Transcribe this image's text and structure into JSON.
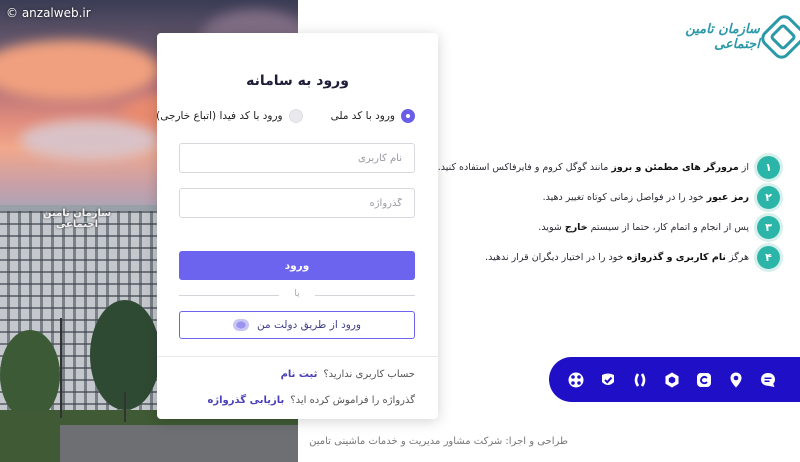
{
  "watermark": "© anzalweb.ir",
  "photo": {
    "building_sign": "سازمان تامین اجتماعی"
  },
  "brand": {
    "logo_text": "سازمان تامین اجتماعی",
    "primary_color": "#6c63ef",
    "accent_color": "#2bb5a8",
    "bar_color": "#1f10c8"
  },
  "login": {
    "title": "ورود به سامانه",
    "radio_options": [
      {
        "label": "ورود با کد ملی",
        "checked": true
      },
      {
        "label": "ورود با کد فیدا (اتباع خارجی)",
        "checked": false
      }
    ],
    "username_placeholder": "نام کاربری",
    "password_placeholder": "گذرواژه",
    "submit_label": "ورود",
    "or_text": "یا",
    "gov_login_label": "ورود از طریق دولت من",
    "no_account_text": "حساب کاربری ندارید؟",
    "register_link": "ثبت نام",
    "forgot_text": "گذرواژه را فراموش کرده اید؟",
    "recover_link": "بازیابی گذرواژه"
  },
  "tips": [
    {
      "num": "۱",
      "pre": "از ",
      "bold": "مرورگر های مطمئن و بروز",
      "post": " مانند گوگل کروم و فایرفاکس استفاده کنید."
    },
    {
      "num": "۲",
      "pre": "",
      "bold": "رمز عبور",
      "post": " خود را در فواصل زمانی کوتاه تغییر دهید."
    },
    {
      "num": "۳",
      "pre": "پس از انجام و اتمام کار، حتما از سیستم ",
      "bold": "خارج",
      "post": " شوید."
    },
    {
      "num": "۴",
      "pre": "هرگز ",
      "bold": "نام کاربری و گذرواژه",
      "post": " خود را در اختیار دیگران قرار ندهید."
    }
  ],
  "social_icons": [
    "chat-icon",
    "location-icon",
    "eitaa-icon",
    "rubika-icon",
    "bale-icon",
    "soroush-icon",
    "aparat-icon"
  ],
  "credit": "طراحی و اجرا: شرکت مشاور مدیریت و خدمات ماشینی تامین"
}
